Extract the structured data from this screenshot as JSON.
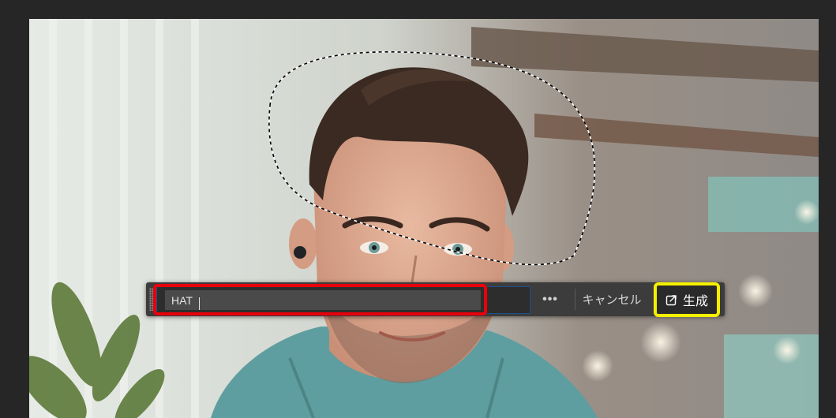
{
  "generative_bar": {
    "prompt_value": "HAT",
    "more_label": "•••",
    "cancel_label": "キャンセル",
    "generate_label": "生成"
  },
  "icons": {
    "grip": "drag-handle-icon",
    "generate": "generate-icon"
  },
  "colors": {
    "highlight_red": "#e8000b",
    "highlight_yellow": "#f5ef00",
    "bar_bg": "#3c3c3c",
    "input_focus_border": "#1e4f8e"
  }
}
